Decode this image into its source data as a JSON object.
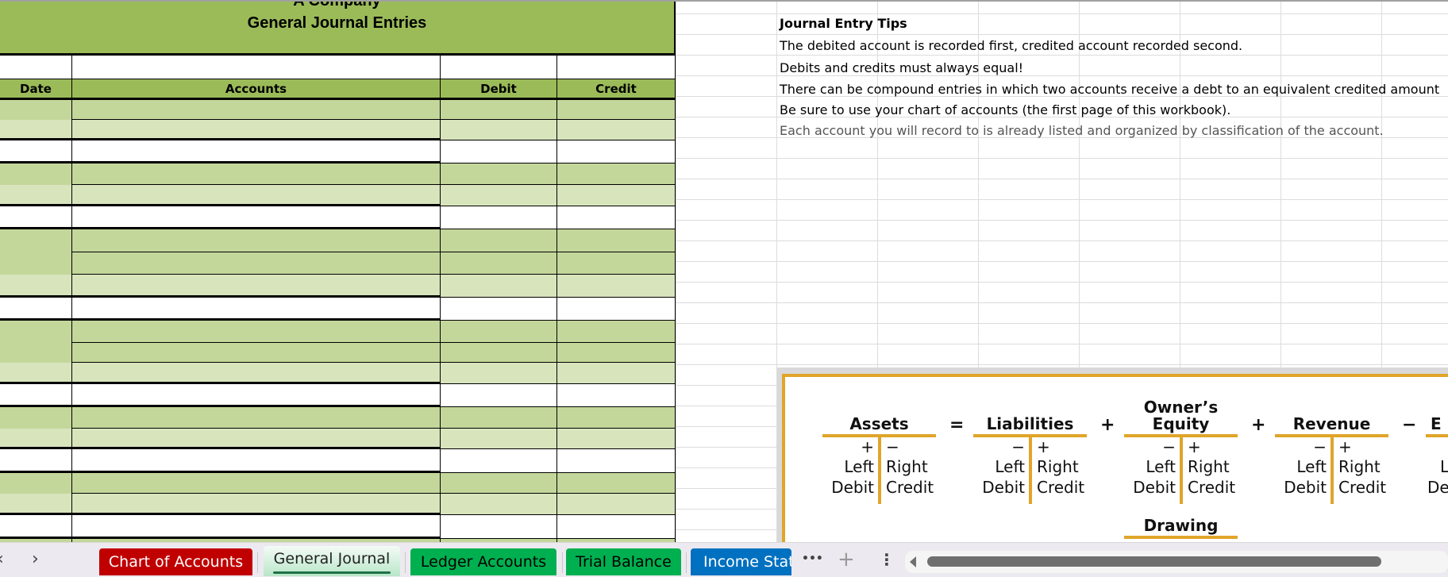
{
  "sheet": {
    "company": "A Company",
    "title": "General Journal Entries",
    "columns": [
      "Date",
      "Accounts",
      "Debit",
      "Credit"
    ],
    "colors": {
      "header": "#9bbb59",
      "row_dark": "#c4d79b",
      "row_light": "#d8e4bc"
    }
  },
  "tips": {
    "title": "Journal Entry Tips",
    "lines": [
      "The debited account is recorded first, credited account recorded second.",
      "Debits and credits must always equal!",
      "There can be compound entries in which two accounts receive a debt to an equivalent credited amount",
      "Be sure to use your chart of accounts (the first page of this workbook).",
      "Each account you will record to is already listed and organized by classification of the account."
    ]
  },
  "diagram": {
    "accounts": [
      {
        "name": "Assets",
        "left_sign": "+",
        "right_sign": "−",
        "left1": "Left",
        "left2": "Debit",
        "right1": "Right",
        "right2": "Credit"
      },
      {
        "name": "Liabilities",
        "left_sign": "−",
        "right_sign": "+",
        "left1": "Left",
        "left2": "Debit",
        "right1": "Right",
        "right2": "Credit"
      },
      {
        "name_line1": "Owner’s",
        "name": "Equity",
        "left_sign": "−",
        "right_sign": "+",
        "left1": "Left",
        "left2": "Debit",
        "right1": "Right",
        "right2": "Credit"
      },
      {
        "name": "Revenue",
        "left_sign": "−",
        "right_sign": "+",
        "left1": "Left",
        "left2": "Debit",
        "right1": "Right",
        "right2": "Credit"
      },
      {
        "name": "E",
        "left1": "Le",
        "left2": "De"
      }
    ],
    "operators": [
      "=",
      "+",
      "+",
      "−"
    ],
    "drawing": "Drawing",
    "accent": "#e0a52a"
  },
  "tabbar": {
    "prev": "‹",
    "next": "›",
    "tabs": [
      {
        "label": "Chart of Accounts",
        "color": "#c00000",
        "text_color": "#ffffff"
      },
      {
        "label": "General Journal",
        "active": true
      },
      {
        "label": "Ledger Accounts",
        "color": "#00b050",
        "text_color": "#000000"
      },
      {
        "label": "Trial Balance",
        "color": "#00b050",
        "text_color": "#000000"
      },
      {
        "label": "Income Stat",
        "color": "#0070c0",
        "text_color": "#ffffff"
      }
    ],
    "more": "•••",
    "add": "+",
    "options": "⋮"
  }
}
